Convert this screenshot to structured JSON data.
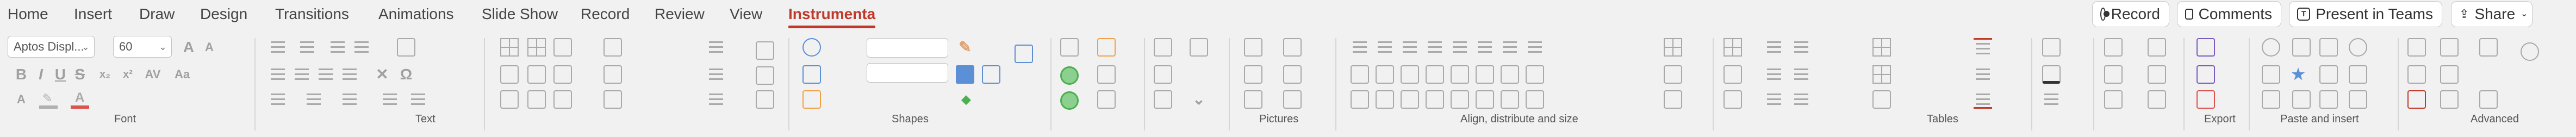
{
  "tabs": {
    "home": "Home",
    "insert": "Insert",
    "draw": "Draw",
    "design": "Design",
    "transitions": "Transitions",
    "animations": "Animations",
    "slideshow": "Slide Show",
    "record": "Record",
    "review": "Review",
    "view": "View",
    "instrumenta": "Instrumenta"
  },
  "actions": {
    "record": "Record",
    "comments": "Comments",
    "present": "Present in Teams",
    "share": "Share"
  },
  "font": {
    "family": "Aptos Displ...",
    "size": "60"
  },
  "groups": {
    "font": "Font",
    "text": "Text",
    "shapes": "Shapes",
    "pictures": "Pictures",
    "align": "Align, distribute and size",
    "tables": "Tables",
    "export": "Export",
    "paste": "Paste and insert",
    "advanced": "Advanced"
  },
  "colors": {
    "accent": "#c0392b",
    "green": "#4caf50",
    "blue": "#5b8fd6",
    "orange": "#f0a04b"
  }
}
